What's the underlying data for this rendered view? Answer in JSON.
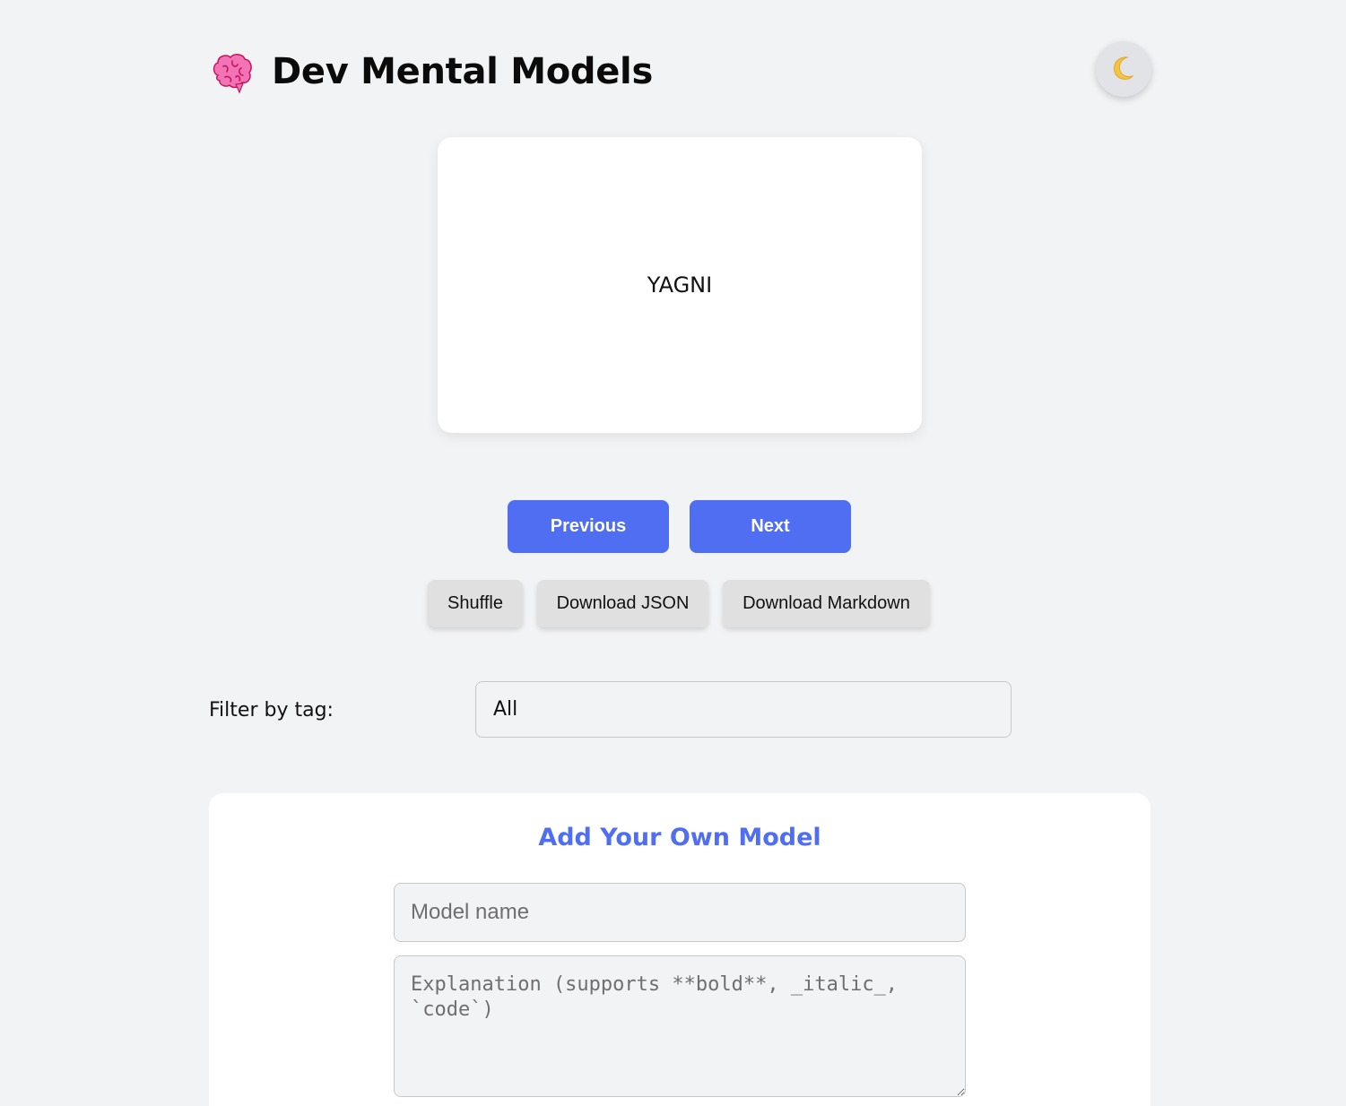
{
  "header": {
    "title": "Dev Mental Models",
    "logo_icon": "brain-icon",
    "theme_toggle_icon": "moon-icon"
  },
  "card": {
    "front_text": "YAGNI"
  },
  "navigation": {
    "previous_label": "Previous",
    "next_label": "Next"
  },
  "actions": {
    "shuffle_label": "Shuffle",
    "download_json_label": "Download JSON",
    "download_markdown_label": "Download Markdown"
  },
  "filter": {
    "label": "Filter by tag:",
    "selected": "All"
  },
  "add_model": {
    "title": "Add Your Own Model",
    "name_placeholder": "Model name",
    "explanation_placeholder": "Explanation (supports **bold**, _italic_, `code`)"
  },
  "colors": {
    "accent": "#4f6ef2",
    "background": "#f2f3f5",
    "card": "#ffffff",
    "secondary_button": "#e0e0e0",
    "brain": "#f472b6"
  }
}
